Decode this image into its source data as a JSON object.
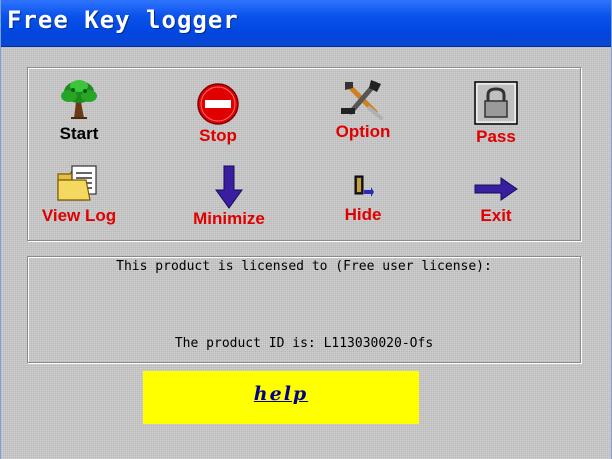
{
  "window": {
    "title": "Free Key logger"
  },
  "toolbar": {
    "start": {
      "label": "Start",
      "icon": "tree-icon"
    },
    "stop": {
      "label": "Stop",
      "icon": "stop-icon"
    },
    "option": {
      "label": "Option",
      "icon": "tools-icon"
    },
    "pass": {
      "label": "Pass",
      "icon": "lock-icon"
    },
    "view_log": {
      "label": "View Log",
      "icon": "folder-icon"
    },
    "minimize": {
      "label": "Minimize",
      "icon": "arrow-down-icon"
    },
    "hide": {
      "label": "Hide",
      "icon": "hide-icon"
    },
    "exit": {
      "label": "Exit",
      "icon": "arrow-right-icon"
    }
  },
  "info": {
    "license_text": "This product is licensed to (Free user license):",
    "product_id_text": "The product ID is: L113030020-Ofs"
  },
  "help": {
    "label": "help"
  },
  "colors": {
    "label_red": "#e00000",
    "label_black": "#000000",
    "help_bg": "#ffff00",
    "help_text": "#00008b",
    "titlebar": "#0a52ea"
  }
}
